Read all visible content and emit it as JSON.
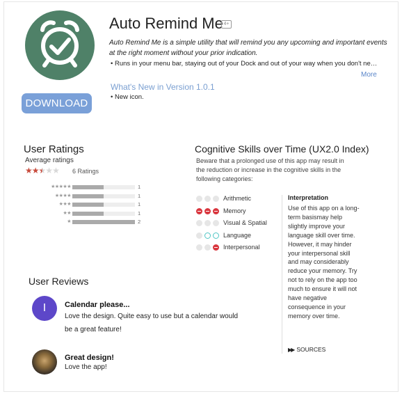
{
  "app": {
    "title": "Auto Remind Me",
    "badge": "4+",
    "description": "Auto Remind Me is a simple utility that will remind you any upcoming and important events at the right moment without your prior indication.",
    "feature": "• Runs in your menu bar, staying out of your Dock and out of your way when you don't need it.",
    "more_label": "More",
    "whats_new_title": "What's New in Version 1.0.1",
    "whats_new_item": "• New icon.",
    "download_label": "DOWNLOAD",
    "icon": "alarm-clock-check-icon",
    "icon_color": "#4f8168",
    "accent_color": "#7aa0d8"
  },
  "ratings": {
    "title": "User Ratings",
    "average_label": "Average ratings",
    "average_stars": 2.5,
    "count_label": "6 Ratings",
    "histogram": [
      {
        "stars": "★★★★★",
        "count": "1",
        "fraction": 0.5
      },
      {
        "stars": "★★★★",
        "count": "1",
        "fraction": 0.5
      },
      {
        "stars": "★★★",
        "count": "1",
        "fraction": 0.5
      },
      {
        "stars": "★★",
        "count": "1",
        "fraction": 0.5
      },
      {
        "stars": "★",
        "count": "2",
        "fraction": 1.0
      }
    ]
  },
  "cognitive": {
    "title": "Cognitive Skills over Time (UX2.0 Index)",
    "description": "Beware that a prolonged use of this app may result in the reduction or increase in the cognitive skills in the following categories:",
    "skills": [
      {
        "label": "Arithmetic",
        "dots": [
          "neutral",
          "neutral",
          "neutral"
        ]
      },
      {
        "label": "Memory",
        "dots": [
          "neg",
          "neg",
          "neg"
        ]
      },
      {
        "label": "Visual & Spatial",
        "dots": [
          "neutral",
          "neutral",
          "neutral"
        ]
      },
      {
        "label": "Language",
        "dots": [
          "neutral",
          "pos",
          "pos"
        ]
      },
      {
        "label": "Interpersonal",
        "dots": [
          "neutral",
          "neutral",
          "neg"
        ]
      }
    ],
    "interpretation_title": "Interpretation",
    "interpretation_body": "Use of this app on a long-term basismay help slightly improve your language skill over time. However, it may hinder your interpersonal skill and may considerably reduce your memory. Try not to rely on the app too much to ensure it will not have negative consequence in your memory over time.",
    "sources_label": "SOURCES",
    "negative_color": "#d9363e",
    "positive_color": "#4fc6c4"
  },
  "reviews": {
    "title": "User Reviews",
    "items": [
      {
        "avatar_letter": "I",
        "title": "Calendar please...",
        "body": "Love the design. Quite easy to use but a calendar would be a great feature!"
      },
      {
        "avatar_letter": "",
        "title": "Great design!",
        "body": "Love the app!"
      }
    ]
  }
}
